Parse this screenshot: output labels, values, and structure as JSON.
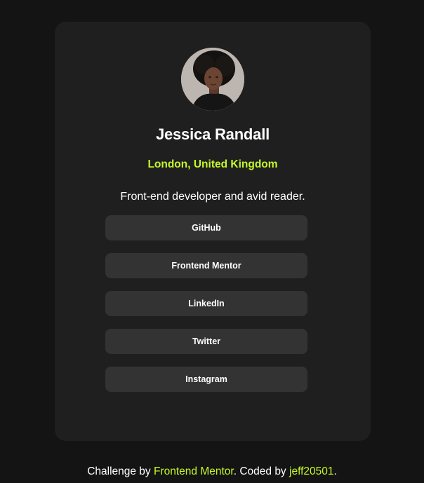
{
  "profile": {
    "name": "Jessica Randall",
    "location": "London, United Kingdom",
    "bio": "Front-end developer and avid reader.",
    "avatar_icon": "profile-photo"
  },
  "links": [
    {
      "label": "GitHub"
    },
    {
      "label": "Frontend Mentor"
    },
    {
      "label": "LinkedIn"
    },
    {
      "label": "Twitter"
    },
    {
      "label": "Instagram"
    }
  ],
  "footer": {
    "prefix": "Challenge by ",
    "challenge_link": "Frontend Mentor",
    "middle": ". Coded by ",
    "author_link": "jeff20501",
    "suffix": "."
  },
  "colors": {
    "page_bg": "#141414",
    "card_bg": "#1f1f1f",
    "button_bg": "#333333",
    "accent": "#c4f82a",
    "text": "#ffffff"
  }
}
